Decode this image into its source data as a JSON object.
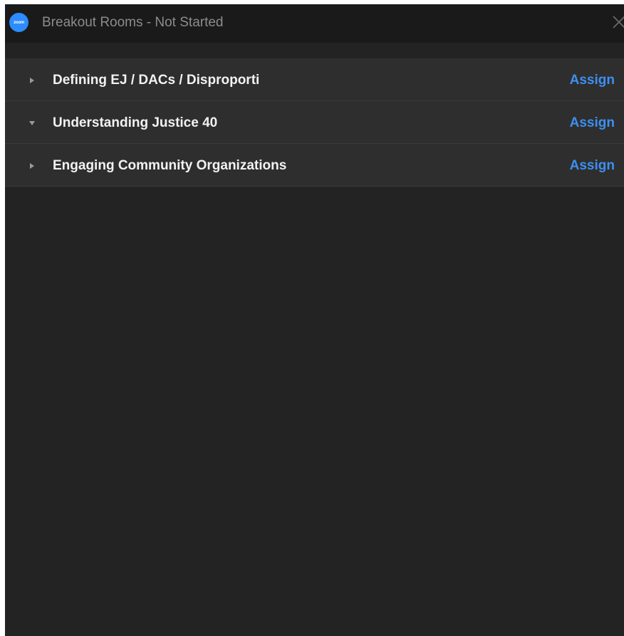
{
  "window": {
    "title": "Breakout Rooms - Not Started",
    "logo_text": "zoom"
  },
  "rooms": [
    {
      "label": "Defining EJ / DACs / Disproporti",
      "expanded": false,
      "action": "Assign"
    },
    {
      "label": "Understanding Justice 40",
      "expanded": true,
      "action": "Assign"
    },
    {
      "label": "Engaging Community Organizations",
      "expanded": false,
      "action": "Assign"
    }
  ],
  "colors": {
    "background": "#232323",
    "titlebar": "#1a1a1a",
    "row": "#2e2e2e",
    "accent": "#3d8ff0",
    "logo": "#2d8cff"
  },
  "icons": {
    "logo": "zoom-logo-icon",
    "close": "close-icon",
    "collapsed": "caret-right-icon",
    "expanded": "caret-down-icon"
  }
}
